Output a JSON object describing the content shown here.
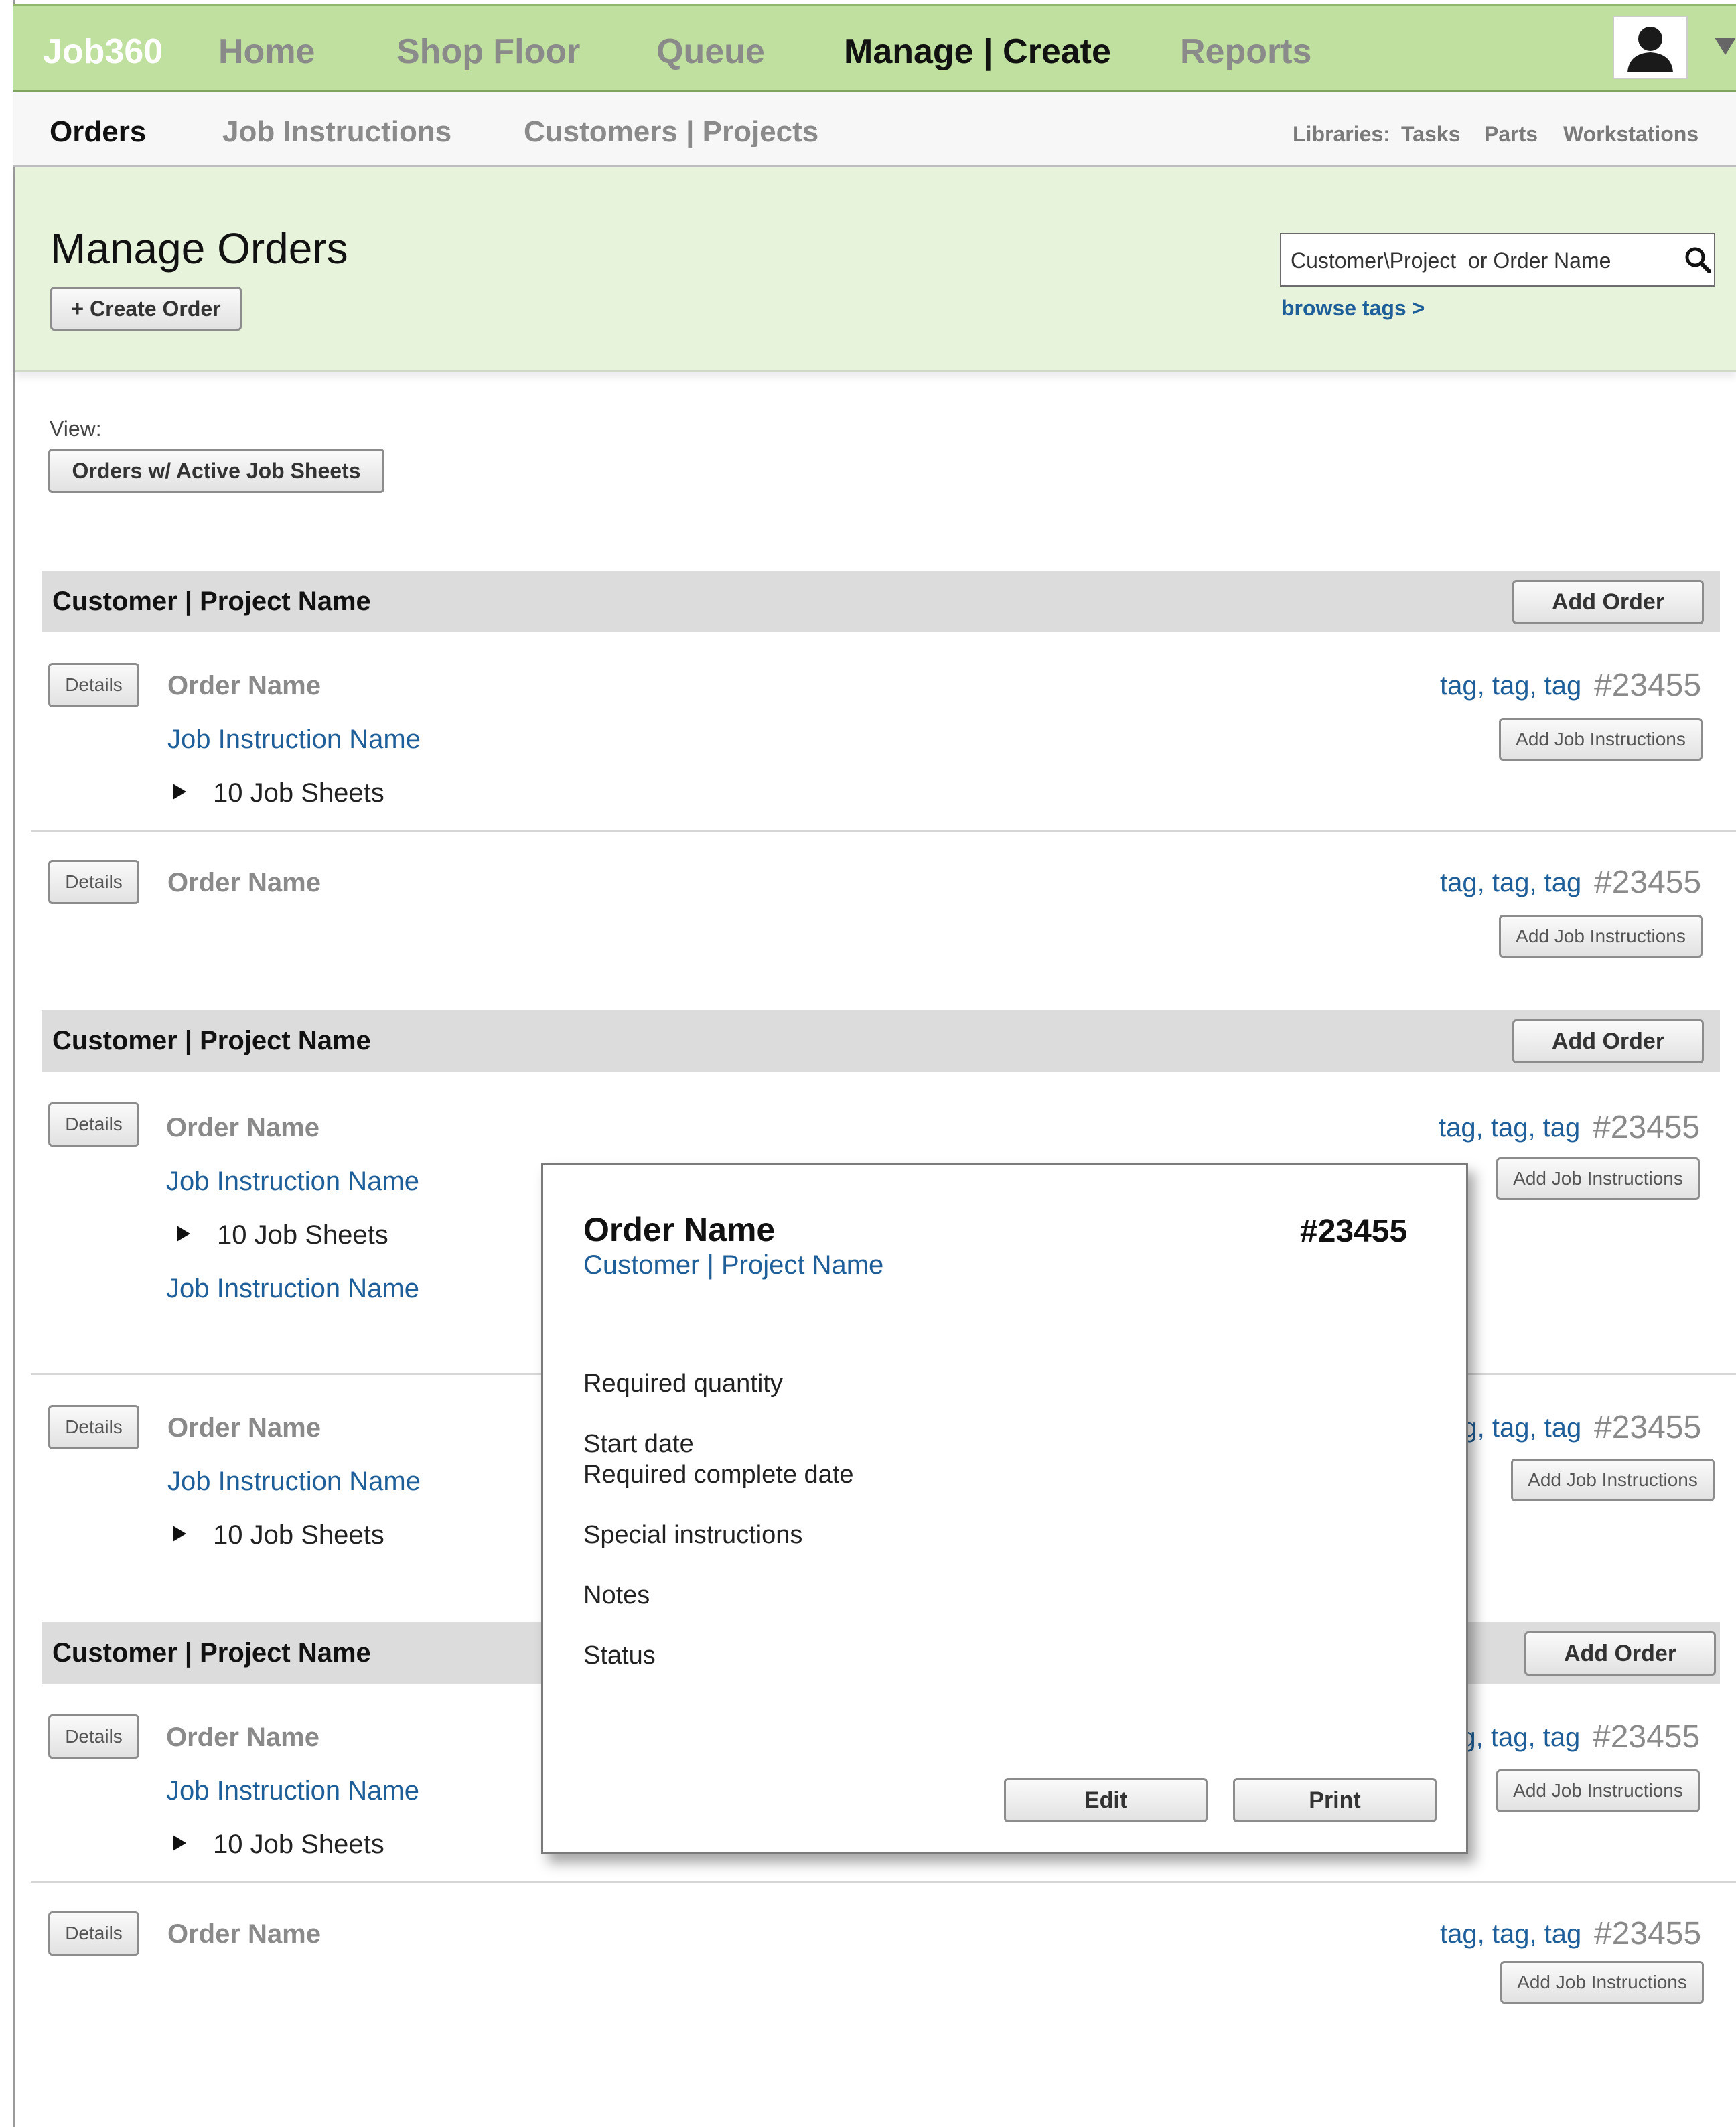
{
  "nav": {
    "brand": "Job360",
    "items": [
      "Home",
      "Shop Floor",
      "Queue",
      "Manage | Create",
      "Reports"
    ]
  },
  "subnav": {
    "items": [
      "Orders",
      "Job Instructions",
      "Customers | Projects"
    ],
    "libraries_label": "Libraries:",
    "libraries": [
      "Tasks",
      "Parts",
      "Workstations"
    ]
  },
  "header": {
    "title": "Manage Orders",
    "create_order_label": "+ Create Order",
    "search_placeholder": "Customer\\Project  or Order Name",
    "browse_tags": "browse tags >"
  },
  "view": {
    "label": "View:",
    "selected": "Orders w/ Active Job Sheets"
  },
  "labels": {
    "details": "Details",
    "add_order": "Add Order",
    "add_job_instructions": "Add Job Instructions",
    "order_name": "Order Name",
    "job_instruction_name": "Job Instruction Name",
    "job_sheets": "10 Job Sheets",
    "tags": "tag, tag, tag",
    "order_number": "#23455",
    "customer_project": "Customer | Project Name"
  },
  "modal": {
    "title": "Order Name",
    "number": "#23455",
    "customer": "Customer | Project Name",
    "fields": [
      "Required quantity",
      "Start date",
      "Required complete date",
      "Special instructions",
      "Notes",
      "Status"
    ],
    "edit_label": "Edit",
    "print_label": "Print"
  },
  "colors": {
    "nav_bg": "#bfe09e",
    "header_bg": "#e8f3dc",
    "link": "#1f5f99",
    "group_header_bg": "#dcdcdc"
  }
}
